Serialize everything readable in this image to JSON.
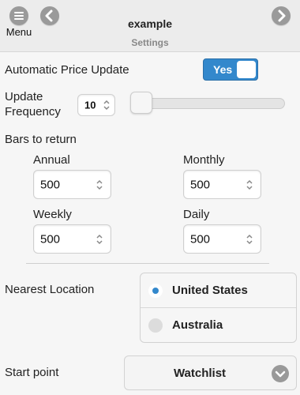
{
  "header": {
    "menu_label": "Menu",
    "title": "example",
    "subtitle": "Settings",
    "icons": {
      "menu": "hamburger-icon",
      "back": "chevron-left-icon",
      "forward": "chevron-right-icon"
    }
  },
  "auto_update": {
    "label": "Automatic Price Update",
    "toggle_label": "Yes",
    "checked": true
  },
  "frequency": {
    "label_line1": "Update",
    "label_line2": "Frequency",
    "value": "10",
    "slider_fraction": 0.0
  },
  "bars": {
    "label": "Bars to return",
    "annual": {
      "label": "Annual",
      "value": "500"
    },
    "monthly": {
      "label": "Monthly",
      "value": "500"
    },
    "weekly": {
      "label": "Weekly",
      "value": "500"
    },
    "daily": {
      "label": "Daily",
      "value": "500"
    }
  },
  "location": {
    "label": "Nearest Location",
    "options": [
      {
        "label": "United States",
        "selected": true
      },
      {
        "label": "Australia",
        "selected": false
      }
    ]
  },
  "start_point": {
    "label": "Start point",
    "value": "Watchlist"
  },
  "colors": {
    "accent": "#3388cc",
    "header_bg": "#ececec",
    "page_bg": "#f6f6f6"
  }
}
